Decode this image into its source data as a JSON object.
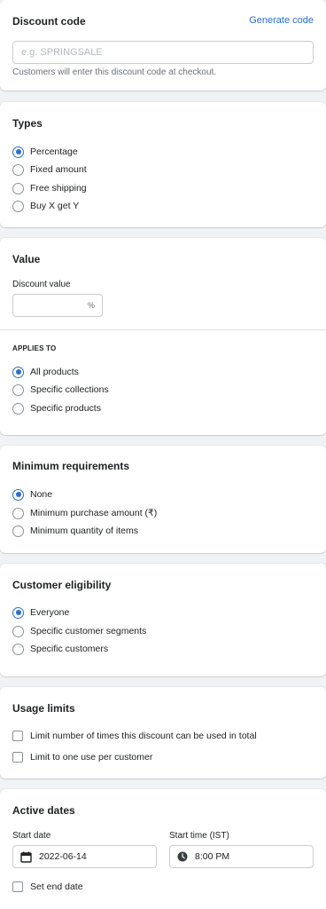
{
  "discount_code": {
    "title": "Discount code",
    "generate_link": "Generate code",
    "placeholder": "e.g. SPRINGSALE",
    "help": "Customers will enter this discount code at checkout."
  },
  "types": {
    "title": "Types",
    "options": [
      "Percentage",
      "Fixed amount",
      "Free shipping",
      "Buy X get Y"
    ],
    "selected": "Percentage"
  },
  "value": {
    "title": "Value",
    "field_label": "Discount value",
    "suffix": "%",
    "applies_to_title": "APPLIES TO",
    "applies_to_options": [
      "All products",
      "Specific collections",
      "Specific products"
    ],
    "applies_to_selected": "All products"
  },
  "minimum_requirements": {
    "title": "Minimum requirements",
    "options": [
      "None",
      "Minimum purchase amount (₹)",
      "Minimum quantity of items"
    ],
    "selected": "None"
  },
  "customer_eligibility": {
    "title": "Customer eligibility",
    "options": [
      "Everyone",
      "Specific customer segments",
      "Specific customers"
    ],
    "selected": "Everyone"
  },
  "usage_limits": {
    "title": "Usage limits",
    "options": [
      "Limit number of times this discount can be used in total",
      "Limit to one use per customer"
    ]
  },
  "active_dates": {
    "title": "Active dates",
    "start_date_label": "Start date",
    "start_date_value": "2022-06-14",
    "start_time_label": "Start time (IST)",
    "start_time_value": "8:00 PM",
    "set_end_date_label": "Set end date"
  },
  "colors": {
    "accent": "#2c6ecb",
    "background": "#f1f2f4",
    "card": "#ffffff",
    "text": "#202223",
    "muted": "#6d7175",
    "border": "#c9cccf"
  }
}
